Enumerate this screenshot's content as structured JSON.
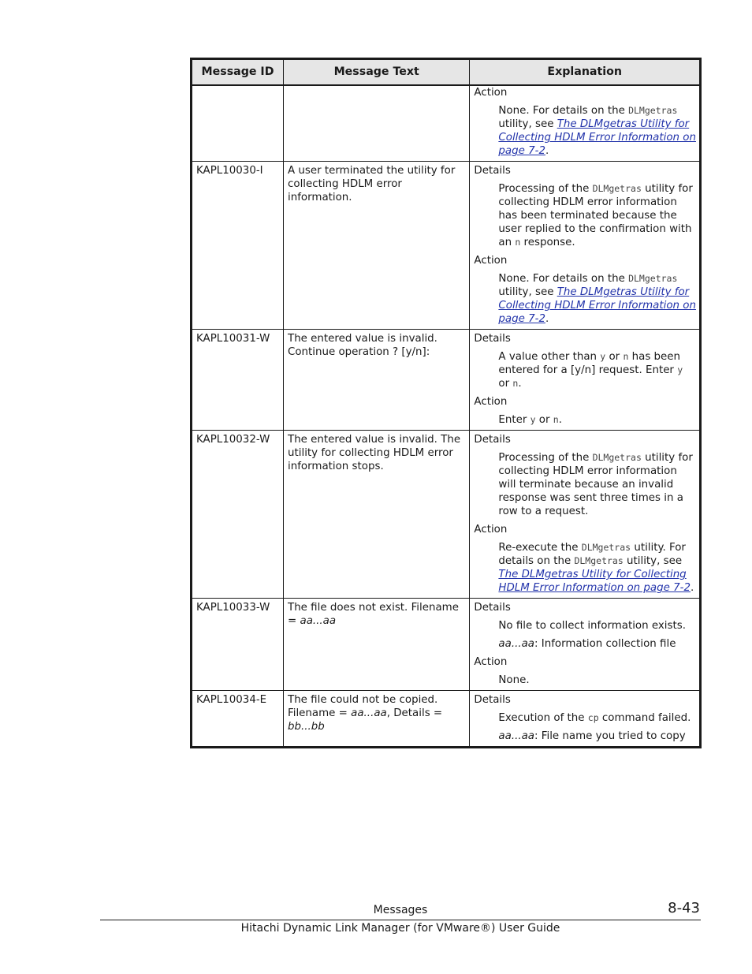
{
  "table": {
    "headers": [
      "Message ID",
      "Message Text",
      "Explanation"
    ],
    "rows": [
      {
        "id": "",
        "text": [],
        "explanation": [
          {
            "label": "Action",
            "paras": [
              [
                {
                  "t": "None. For details on the "
                },
                {
                  "t": "DLMgetras",
                  "s": "mono"
                },
                {
                  "t": " utility, see "
                },
                {
                  "t": "The DLMgetras Utility for Collecting HDLM Error Information on page 7-2",
                  "s": "link"
                },
                {
                  "t": "."
                }
              ]
            ]
          }
        ]
      },
      {
        "id": "KAPL10030-I",
        "text": [
          {
            "t": "A user terminated the utility for collecting HDLM error information."
          }
        ],
        "explanation": [
          {
            "label": "Details",
            "paras": [
              [
                {
                  "t": "Processing of the "
                },
                {
                  "t": "DLMgetras",
                  "s": "mono"
                },
                {
                  "t": " utility for collecting HDLM error information has been terminated because the user replied to the confirmation with an "
                },
                {
                  "t": "n",
                  "s": "mono"
                },
                {
                  "t": " response."
                }
              ]
            ]
          },
          {
            "label": "Action",
            "paras": [
              [
                {
                  "t": "None. For details on the "
                },
                {
                  "t": "DLMgetras",
                  "s": "mono"
                },
                {
                  "t": " utility, see "
                },
                {
                  "t": "The DLMgetras Utility for Collecting HDLM Error Information on page 7-2",
                  "s": "link"
                },
                {
                  "t": "."
                }
              ]
            ]
          }
        ]
      },
      {
        "id": "KAPL10031-W",
        "text": [
          {
            "t": "The entered value is invalid. Continue operation ? [y/n]:"
          }
        ],
        "explanation": [
          {
            "label": "Details",
            "paras": [
              [
                {
                  "t": "A value other than "
                },
                {
                  "t": "y",
                  "s": "mono"
                },
                {
                  "t": " or "
                },
                {
                  "t": "n",
                  "s": "mono"
                },
                {
                  "t": " has been entered for a [y/n] request. Enter "
                },
                {
                  "t": "y",
                  "s": "mono"
                },
                {
                  "t": " or "
                },
                {
                  "t": "n",
                  "s": "mono"
                },
                {
                  "t": "."
                }
              ]
            ]
          },
          {
            "label": "Action",
            "paras": [
              [
                {
                  "t": "Enter "
                },
                {
                  "t": "y",
                  "s": "mono"
                },
                {
                  "t": " or "
                },
                {
                  "t": "n",
                  "s": "mono"
                },
                {
                  "t": "."
                }
              ]
            ]
          }
        ]
      },
      {
        "id": "KAPL10032-W",
        "text": [
          {
            "t": "The entered value is invalid. The utility for collecting HDLM error information stops."
          }
        ],
        "explanation": [
          {
            "label": "Details",
            "paras": [
              [
                {
                  "t": "Processing of the "
                },
                {
                  "t": "DLMgetras",
                  "s": "mono"
                },
                {
                  "t": " utility for collecting HDLM error information will terminate because an invalid response was sent three times in a row to a request."
                }
              ]
            ]
          },
          {
            "label": "Action",
            "paras": [
              [
                {
                  "t": "Re-execute the "
                },
                {
                  "t": "DLMgetras",
                  "s": "mono"
                },
                {
                  "t": " utility. For details on the "
                },
                {
                  "t": "DLMgetras",
                  "s": "mono"
                },
                {
                  "t": " utility, see "
                },
                {
                  "t": "The DLMgetras Utility for Collecting HDLM Error Information on page 7-2",
                  "s": "link"
                },
                {
                  "t": "."
                }
              ]
            ]
          }
        ]
      },
      {
        "id": "KAPL10033-W",
        "text": [
          {
            "t": "The file does not exist. Filename = "
          },
          {
            "t": "aa...aa",
            "s": "var"
          }
        ],
        "explanation": [
          {
            "label": "Details",
            "paras": [
              [
                {
                  "t": "No file to collect information exists."
                }
              ],
              [
                {
                  "t": "aa...aa",
                  "s": "var"
                },
                {
                  "t": ": Information collection file"
                }
              ]
            ]
          },
          {
            "label": "Action",
            "paras": [
              [
                {
                  "t": "None."
                }
              ]
            ]
          }
        ]
      },
      {
        "id": "KAPL10034-E",
        "text": [
          {
            "t": "The file could not be copied. Filename = "
          },
          {
            "t": "aa...aa",
            "s": "var"
          },
          {
            "t": ", Details = "
          },
          {
            "t": "bb...bb",
            "s": "var"
          }
        ],
        "explanation": [
          {
            "label": "Details",
            "paras": [
              [
                {
                  "t": "Execution of the "
                },
                {
                  "t": "cp",
                  "s": "mono"
                },
                {
                  "t": " command failed."
                }
              ],
              [
                {
                  "t": "aa...aa",
                  "s": "var"
                },
                {
                  "t": ": File name you tried to copy"
                }
              ]
            ]
          }
        ]
      }
    ]
  },
  "footer": {
    "section": "Messages",
    "page_number": "8-43",
    "guide_title": "Hitachi Dynamic Link Manager (for VMware®) User Guide"
  }
}
